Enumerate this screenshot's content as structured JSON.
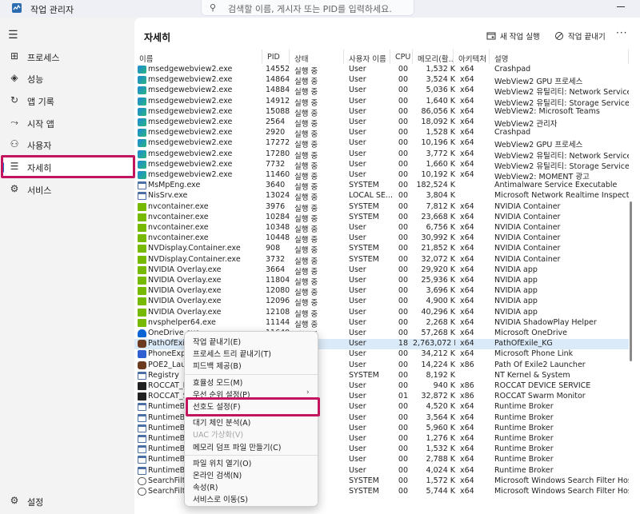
{
  "window": {
    "title": "작업 관리자"
  },
  "search": {
    "placeholder": "검색할 이름, 게시자 또는 PID를 입력하세요."
  },
  "sidebar": {
    "items": [
      {
        "label": "프로세스",
        "icon": "processes-icon"
      },
      {
        "label": "성능",
        "icon": "performance-icon"
      },
      {
        "label": "앱 기록",
        "icon": "app-history-icon"
      },
      {
        "label": "시작 앱",
        "icon": "startup-apps-icon"
      },
      {
        "label": "사용자",
        "icon": "users-icon"
      },
      {
        "label": "자세히",
        "icon": "details-icon",
        "active": true
      },
      {
        "label": "서비스",
        "icon": "services-icon"
      }
    ],
    "settings_label": "설정"
  },
  "header": {
    "title": "자세히",
    "new_task": "새 작업 실행",
    "end_task": "작업 끝내기"
  },
  "table": {
    "columns": [
      "이름",
      "PID",
      "상태",
      "사용자 이름",
      "CPU",
      "메모리(활...",
      "아키텍처",
      "설명"
    ],
    "rows": [
      {
        "name": "msedgewebview2.exe",
        "pid": "14552",
        "status": "실행 중",
        "user": "User",
        "cpu": "00",
        "mem": "1,532 K",
        "arch": "x64",
        "desc": "Crashpad",
        "icon": "edge"
      },
      {
        "name": "msedgewebview2.exe",
        "pid": "14864",
        "status": "실행 중",
        "user": "User",
        "cpu": "00",
        "mem": "3,524 K",
        "arch": "x64",
        "desc": "WebView2 GPU 프로세스",
        "icon": "edge"
      },
      {
        "name": "msedgewebview2.exe",
        "pid": "14884",
        "status": "실행 중",
        "user": "User",
        "cpu": "00",
        "mem": "5,036 K",
        "arch": "x64",
        "desc": "WebView2 유틸리티: Network Service",
        "icon": "edge"
      },
      {
        "name": "msedgewebview2.exe",
        "pid": "14912",
        "status": "실행 중",
        "user": "User",
        "cpu": "00",
        "mem": "1,640 K",
        "arch": "x64",
        "desc": "WebView2 유틸리티: Storage Service",
        "icon": "edge"
      },
      {
        "name": "msedgewebview2.exe",
        "pid": "15088",
        "status": "실행 중",
        "user": "User",
        "cpu": "00",
        "mem": "86,056 K",
        "arch": "x64",
        "desc": "WebView2: Microsoft Teams",
        "icon": "edge"
      },
      {
        "name": "msedgewebview2.exe",
        "pid": "2564",
        "status": "실행 중",
        "user": "User",
        "cpu": "00",
        "mem": "18,092 K",
        "arch": "x64",
        "desc": "WebView2 관리자",
        "icon": "edge"
      },
      {
        "name": "msedgewebview2.exe",
        "pid": "2920",
        "status": "실행 중",
        "user": "User",
        "cpu": "00",
        "mem": "1,528 K",
        "arch": "x64",
        "desc": "Crashpad",
        "icon": "edge"
      },
      {
        "name": "msedgewebview2.exe",
        "pid": "17272",
        "status": "실행 중",
        "user": "User",
        "cpu": "00",
        "mem": "10,196 K",
        "arch": "x64",
        "desc": "WebView2 GPU 프로세스",
        "icon": "edge"
      },
      {
        "name": "msedgewebview2.exe",
        "pid": "17280",
        "status": "실행 중",
        "user": "User",
        "cpu": "00",
        "mem": "3,772 K",
        "arch": "x64",
        "desc": "WebView2 유틸리티: Network Service",
        "icon": "edge"
      },
      {
        "name": "msedgewebview2.exe",
        "pid": "7732",
        "status": "실행 중",
        "user": "User",
        "cpu": "00",
        "mem": "1,660 K",
        "arch": "x64",
        "desc": "WebView2 유틸리티: Storage Service",
        "icon": "edge"
      },
      {
        "name": "msedgewebview2.exe",
        "pid": "11460",
        "status": "실행 중",
        "user": "User",
        "cpu": "00",
        "mem": "10,192 K",
        "arch": "x64",
        "desc": "WebView2: MOMENT 광고",
        "icon": "edge"
      },
      {
        "name": "MsMpEng.exe",
        "pid": "3640",
        "status": "실행 중",
        "user": "SYSTEM",
        "cpu": "00",
        "mem": "182,524 K",
        "arch": "",
        "desc": "Antimalware Service Executable",
        "icon": "window"
      },
      {
        "name": "NisSrv.exe",
        "pid": "13024",
        "status": "실행 중",
        "user": "LOCAL SE...",
        "cpu": "00",
        "mem": "3,804 K",
        "arch": "",
        "desc": "Microsoft Network Realtime Inspection Servic",
        "icon": "window"
      },
      {
        "name": "nvcontainer.exe",
        "pid": "3976",
        "status": "실행 중",
        "user": "SYSTEM",
        "cpu": "00",
        "mem": "7,812 K",
        "arch": "x64",
        "desc": "NVIDIA Container",
        "icon": "nvidia"
      },
      {
        "name": "nvcontainer.exe",
        "pid": "10284",
        "status": "실행 중",
        "user": "SYSTEM",
        "cpu": "00",
        "mem": "23,668 K",
        "arch": "x64",
        "desc": "NVIDIA Container",
        "icon": "nvidia"
      },
      {
        "name": "nvcontainer.exe",
        "pid": "10348",
        "status": "실행 중",
        "user": "User",
        "cpu": "00",
        "mem": "6,756 K",
        "arch": "x64",
        "desc": "NVIDIA Container",
        "icon": "nvidia"
      },
      {
        "name": "nvcontainer.exe",
        "pid": "10448",
        "status": "실행 중",
        "user": "User",
        "cpu": "00",
        "mem": "30,992 K",
        "arch": "x64",
        "desc": "NVIDIA Container",
        "icon": "nvidia"
      },
      {
        "name": "NVDisplay.Container.exe",
        "pid": "908",
        "status": "실행 중",
        "user": "SYSTEM",
        "cpu": "00",
        "mem": "21,852 K",
        "arch": "x64",
        "desc": "NVIDIA Container",
        "icon": "nvidia"
      },
      {
        "name": "NVDisplay.Container.exe",
        "pid": "3732",
        "status": "실행 중",
        "user": "SYSTEM",
        "cpu": "00",
        "mem": "32,072 K",
        "arch": "x64",
        "desc": "NVIDIA Container",
        "icon": "nvidia"
      },
      {
        "name": "NVIDIA Overlay.exe",
        "pid": "3664",
        "status": "실행 중",
        "user": "User",
        "cpu": "00",
        "mem": "29,920 K",
        "arch": "x64",
        "desc": "NVIDIA app",
        "icon": "nvidia"
      },
      {
        "name": "NVIDIA Overlay.exe",
        "pid": "11804",
        "status": "실행 중",
        "user": "User",
        "cpu": "00",
        "mem": "25,936 K",
        "arch": "x64",
        "desc": "NVIDIA app",
        "icon": "nvidia"
      },
      {
        "name": "NVIDIA Overlay.exe",
        "pid": "12080",
        "status": "실행 중",
        "user": "User",
        "cpu": "00",
        "mem": "3,696 K",
        "arch": "x64",
        "desc": "NVIDIA app",
        "icon": "nvidia"
      },
      {
        "name": "NVIDIA Overlay.exe",
        "pid": "12096",
        "status": "실행 중",
        "user": "User",
        "cpu": "00",
        "mem": "4,900 K",
        "arch": "x64",
        "desc": "NVIDIA app",
        "icon": "nvidia"
      },
      {
        "name": "NVIDIA Overlay.exe",
        "pid": "12108",
        "status": "실행 중",
        "user": "User",
        "cpu": "00",
        "mem": "40,296 K",
        "arch": "x64",
        "desc": "NVIDIA app",
        "icon": "nvidia"
      },
      {
        "name": "nvsphelper64.exe",
        "pid": "11144",
        "status": "실행 중",
        "user": "User",
        "cpu": "00",
        "mem": "2,268 K",
        "arch": "x64",
        "desc": "NVIDIA ShadowPlay Helper",
        "icon": "nvidia"
      },
      {
        "name": "OneDrive.exe",
        "pid": "11640",
        "status": "실행 중",
        "user": "User",
        "cpu": "00",
        "mem": "57,268 K",
        "arch": "x64",
        "desc": "Microsoft OneDrive",
        "icon": "onedrive"
      },
      {
        "name": "PathOfExile_KG.exe",
        "pid": "",
        "status": "",
        "user": "User",
        "cpu": "18",
        "mem": "2,763,072 K",
        "arch": "x64",
        "desc": "PathOfExile_KG",
        "icon": "game",
        "selected": true
      },
      {
        "name": "PhoneExperienceHost.exe",
        "pid": "",
        "status": "",
        "user": "User",
        "cpu": "00",
        "mem": "34,212 K",
        "arch": "x64",
        "desc": "Microsoft Phone Link",
        "icon": "phone"
      },
      {
        "name": "POE2_Launcher.exe",
        "pid": "",
        "status": "",
        "user": "User",
        "cpu": "00",
        "mem": "14,224 K",
        "arch": "x86",
        "desc": "Path Of Exile2 Launcher",
        "icon": "game"
      },
      {
        "name": "Registry",
        "pid": "",
        "status": "",
        "user": "SYSTEM",
        "cpu": "00",
        "mem": "8,192 K",
        "arch": "",
        "desc": "NT Kernel & System",
        "icon": "window"
      },
      {
        "name": "ROCCAT_DEVICE_SERVICE.exe",
        "pid": "",
        "status": "",
        "user": "User",
        "cpu": "00",
        "mem": "940 K",
        "arch": "x86",
        "desc": "ROCCAT DEVICE SERVICE",
        "icon": "roccat"
      },
      {
        "name": "ROCCAT_Swarm_Monitor.exe",
        "pid": "",
        "status": "",
        "user": "User",
        "cpu": "01",
        "mem": "32,872 K",
        "arch": "x86",
        "desc": "ROCCAT Swarm Monitor",
        "icon": "roccat"
      },
      {
        "name": "RuntimeBroker.exe",
        "pid": "",
        "status": "",
        "user": "User",
        "cpu": "00",
        "mem": "4,520 K",
        "arch": "x64",
        "desc": "Runtime Broker",
        "icon": "window"
      },
      {
        "name": "RuntimeBroker.exe",
        "pid": "",
        "status": "",
        "user": "User",
        "cpu": "00",
        "mem": "3,564 K",
        "arch": "x64",
        "desc": "Runtime Broker",
        "icon": "window"
      },
      {
        "name": "RuntimeBroker.exe",
        "pid": "",
        "status": "",
        "user": "User",
        "cpu": "00",
        "mem": "5,960 K",
        "arch": "x64",
        "desc": "Runtime Broker",
        "icon": "window"
      },
      {
        "name": "RuntimeBroker.exe",
        "pid": "",
        "status": "",
        "user": "User",
        "cpu": "00",
        "mem": "1,276 K",
        "arch": "x64",
        "desc": "Runtime Broker",
        "icon": "window"
      },
      {
        "name": "RuntimeBroker.exe",
        "pid": "",
        "status": "",
        "user": "User",
        "cpu": "00",
        "mem": "1,532 K",
        "arch": "x64",
        "desc": "Runtime Broker",
        "icon": "window"
      },
      {
        "name": "RuntimeBroker.exe",
        "pid": "",
        "status": "",
        "user": "User",
        "cpu": "00",
        "mem": "2,788 K",
        "arch": "x64",
        "desc": "Runtime Broker",
        "icon": "window"
      },
      {
        "name": "RuntimeBroker.exe",
        "pid": "",
        "status": "",
        "user": "User",
        "cpu": "00",
        "mem": "4,024 K",
        "arch": "x64",
        "desc": "Runtime Broker",
        "icon": "window"
      },
      {
        "name": "SearchFilterHost.exe",
        "pid": "",
        "status": "",
        "user": "SYSTEM",
        "cpu": "00",
        "mem": "1,572 K",
        "arch": "x64",
        "desc": "Microsoft Windows Search Filter Host",
        "icon": "search"
      },
      {
        "name": "SearchFilterHost.exe",
        "pid": "",
        "status": "",
        "user": "SYSTEM",
        "cpu": "00",
        "mem": "5,744 K",
        "arch": "x64",
        "desc": "Microsoft Windows Search Filter Host",
        "icon": "search"
      }
    ]
  },
  "context_menu": {
    "items": [
      {
        "label": "작업 끝내기(E)"
      },
      {
        "label": "프로세스 트리 끝내기(T)"
      },
      {
        "label": "피드백 제공(B)"
      },
      {
        "separator": true
      },
      {
        "label": "효율성 모드(M)"
      },
      {
        "label": "우선 순위 설정(P)",
        "submenu": true
      },
      {
        "label": "선호도 설정(F)"
      },
      {
        "separator": true
      },
      {
        "label": "대기 체인 분석(A)"
      },
      {
        "label": "UAC 가상화(V)",
        "disabled": true
      },
      {
        "label": "메모리 덤프 파일 만들기(C)"
      },
      {
        "separator": true
      },
      {
        "label": "파일 위치 열기(O)"
      },
      {
        "label": "온라인 검색(N)"
      },
      {
        "label": "속성(R)"
      },
      {
        "label": "서비스로 이동(S)"
      }
    ]
  },
  "colors": {
    "annotation": "#c2155e",
    "selection": "#dbeaf8",
    "accent": "#1a73c8"
  }
}
